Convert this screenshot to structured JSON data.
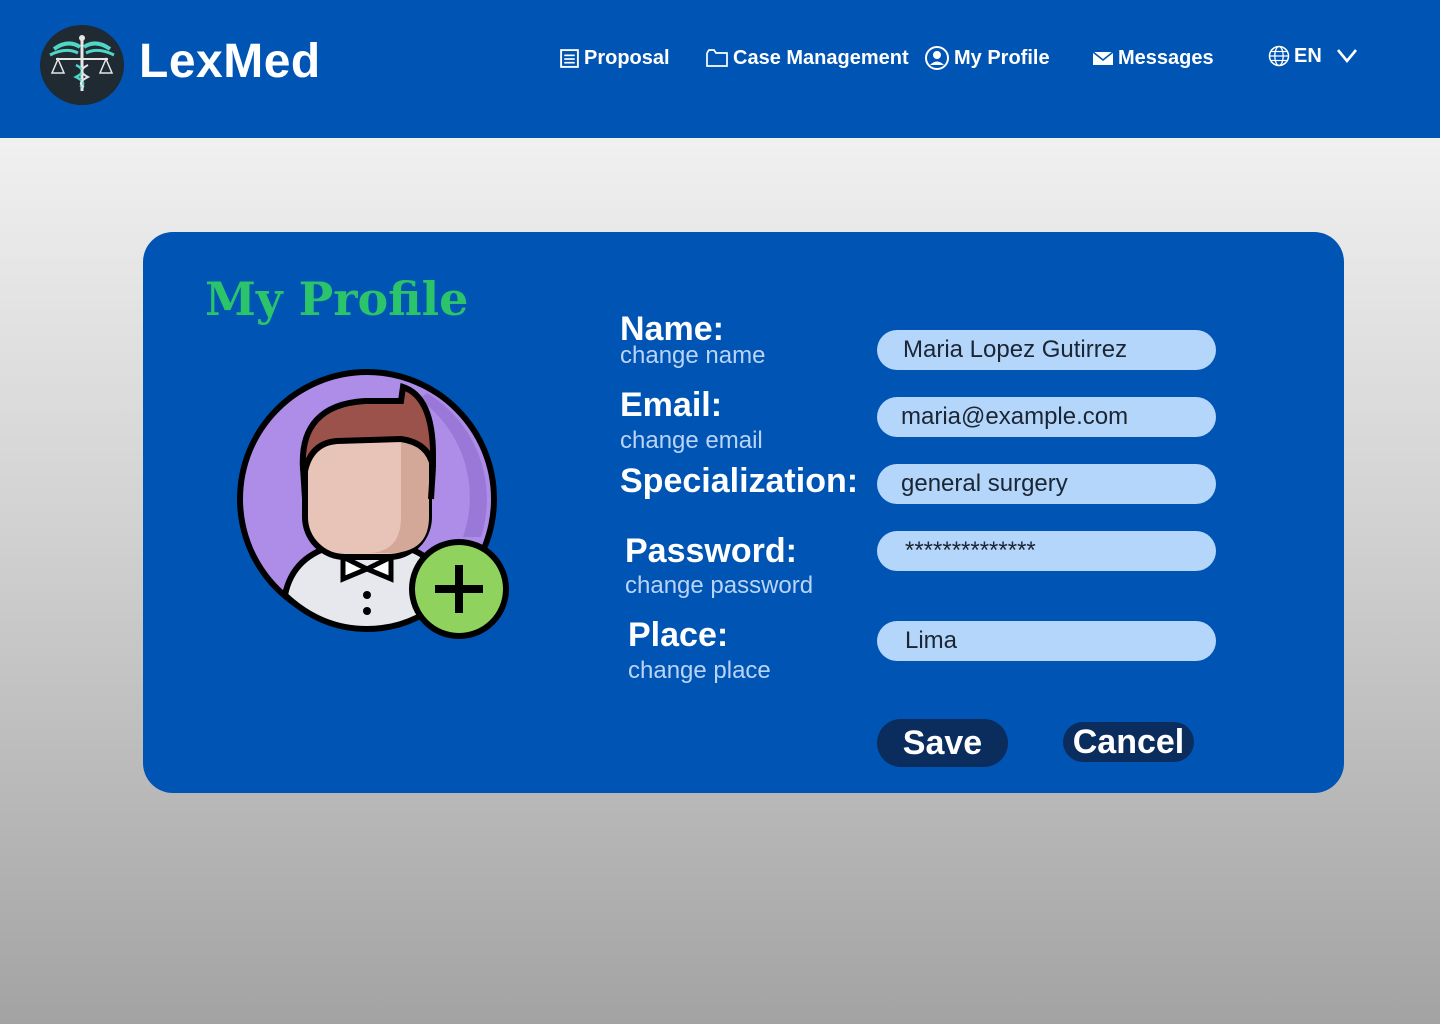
{
  "app": {
    "brand": "LexMed",
    "logo_text": "LexMed logo"
  },
  "nav": {
    "items": [
      {
        "label": "Proposal",
        "icon": "document-icon"
      },
      {
        "label": "Case Management",
        "icon": "folder-icon"
      },
      {
        "label": "My Profile",
        "icon": "user-circle-icon"
      },
      {
        "label": "Messages",
        "icon": "envelope-icon"
      }
    ],
    "language": {
      "label": "EN",
      "icon": "globe-icon"
    }
  },
  "profile": {
    "title": "My Profile",
    "avatar_icon": "add-user-avatar-icon",
    "fields": {
      "name": {
        "label": "Name:",
        "sub": "change name",
        "value": "Maria Lopez Gutirrez"
      },
      "email": {
        "label": "Email:",
        "sub": "change email",
        "value": "maria@example.com"
      },
      "specialization": {
        "label": "Specialization:",
        "value": "general surgery"
      },
      "password": {
        "label": "Password:",
        "sub": "change password",
        "value": "**************"
      },
      "place": {
        "label": "Place:",
        "sub": "change place",
        "value": "Lima"
      }
    },
    "save_label": "Save",
    "cancel_label": "Cancel"
  },
  "colors": {
    "primary": "#0054b4",
    "accent_title": "#2bc46a",
    "input_bg": "#b3d6fa",
    "button_bg": "#0a2d5e"
  }
}
